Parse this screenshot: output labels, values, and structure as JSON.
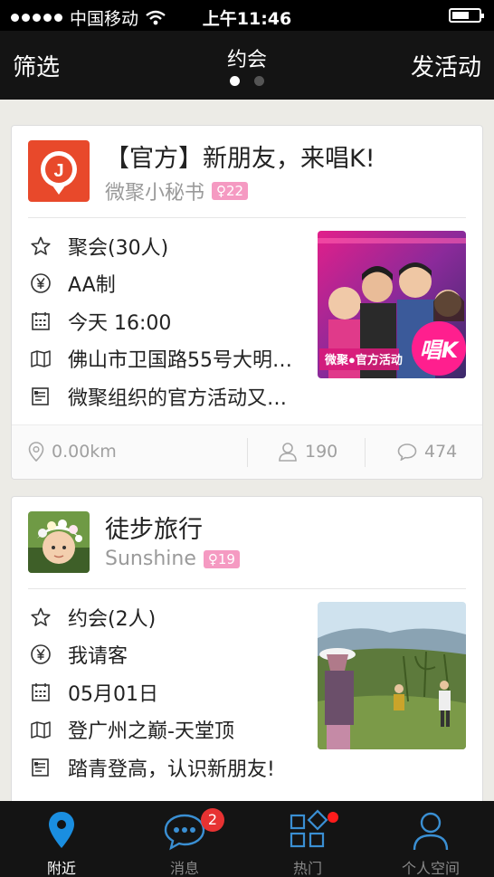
{
  "statusbar": {
    "carrier": "中国移动",
    "time": "上午11:46"
  },
  "navbar": {
    "left_label": "筛选",
    "title": "约会",
    "right_label": "发活动",
    "page_count": 2,
    "active_page": 0
  },
  "colors": {
    "accent_blue": "#1a7fd1",
    "badge_pink": "#f59ac2",
    "notify_red": "#e73232"
  },
  "cards": [
    {
      "title": "【官方】新朋友，来唱K!",
      "organizer": "微聚小秘书",
      "badge": "♀22",
      "type": "聚会(30人)",
      "payment": "AA制",
      "time": "今天 16:00",
      "location": "佛山市卫国路55号大明…",
      "description": "微聚组织的官方活动又来啦!",
      "distance": "0.00km",
      "views": "190",
      "comments": "474",
      "photo_text": "唱K",
      "photo_caption": "微聚●官方活动"
    },
    {
      "title": "徒步旅行",
      "organizer": "Sunshine",
      "badge": "♀19",
      "type": "约会(2人)",
      "payment": "我请客",
      "time": "05月01日",
      "location": "登广州之巅-天堂顶",
      "description": "踏青登高，认识新朋友!"
    }
  ],
  "tabbar": {
    "tabs": [
      {
        "label": "附近",
        "icon": "location-pin-icon",
        "active": true
      },
      {
        "label": "消息",
        "icon": "chat-bubble-icon",
        "badge": "2"
      },
      {
        "label": "热门",
        "icon": "grid-icon",
        "dot": true
      },
      {
        "label": "个人空间",
        "icon": "person-icon"
      }
    ]
  }
}
